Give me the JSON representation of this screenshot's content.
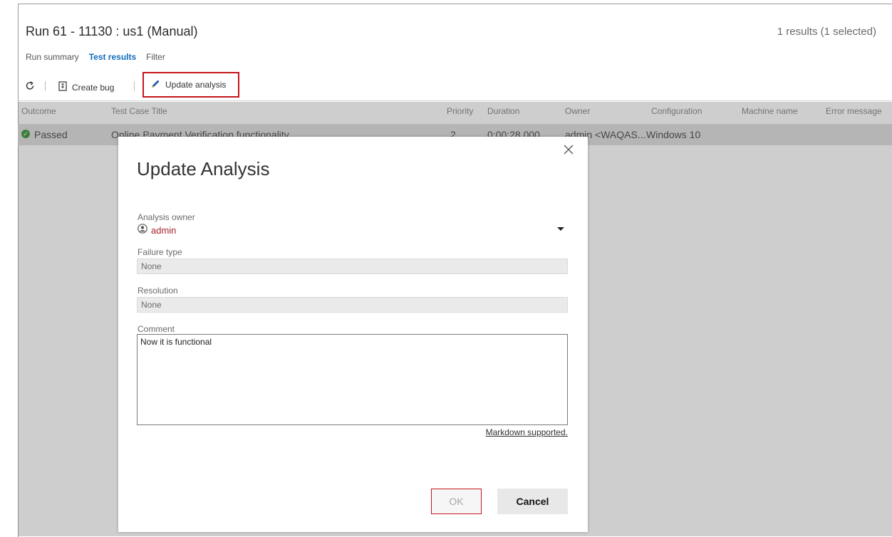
{
  "run": {
    "title": "Run 61 - 11130 : us1 (Manual)",
    "results_summary": "1 results (1 selected)"
  },
  "tabs": [
    {
      "label": "Run summary",
      "active": false
    },
    {
      "label": "Test results",
      "active": true
    },
    {
      "label": "Filter",
      "active": false
    }
  ],
  "toolbar": {
    "refresh_icon": "refresh-icon",
    "create_bug_label": "Create bug",
    "create_bug_icon": "bug-document-icon",
    "update_analysis_label": "Update analysis",
    "update_analysis_icon": "pencil-icon"
  },
  "grid": {
    "columns": [
      "Outcome",
      "Test Case Title",
      "Priority",
      "Duration",
      "Owner",
      "Configuration",
      "Machine name",
      "Error message"
    ],
    "rows": [
      {
        "outcome": "Passed",
        "title": "Online Payment Verification functionality",
        "priority": "2",
        "duration": "0:00:28.000",
        "owner": "admin <WAQAS...",
        "configuration": "Windows 10",
        "machine": "",
        "error": ""
      }
    ]
  },
  "dialog": {
    "title": "Update Analysis",
    "analysis_owner_label": "Analysis owner",
    "analysis_owner_value": "admin",
    "failure_type_label": "Failure type",
    "failure_type_value": "None",
    "resolution_label": "Resolution",
    "resolution_value": "None",
    "comment_label": "Comment",
    "comment_value": "Now it is functional",
    "markdown_link": "Markdown supported.",
    "ok_label": "OK",
    "cancel_label": "Cancel"
  },
  "colors": {
    "accent_link": "#106ebe",
    "highlight_border": "#c4161c",
    "passed_green": "#107c10",
    "owner_red": "#a4262c"
  }
}
